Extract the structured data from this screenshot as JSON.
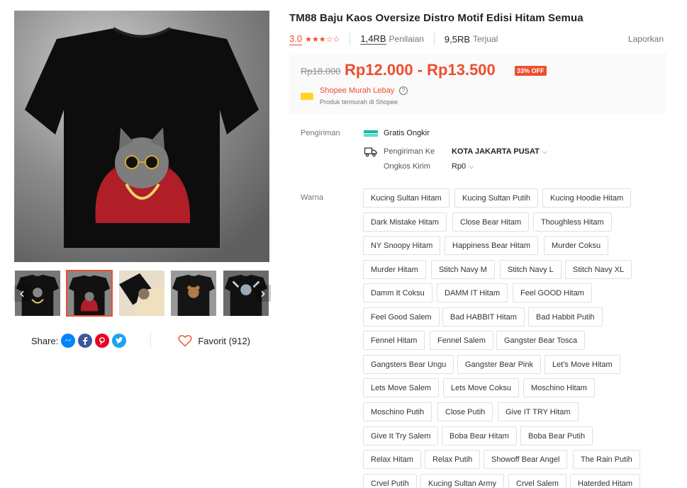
{
  "product": {
    "title": "TM88 Baju Kaos Oversize Distro Motif Edisi Hitam Semua",
    "rating": "3.0",
    "stars": "★★★☆☆",
    "reviews_count": "1,4RB",
    "reviews_label": "Penilaian",
    "sold_count": "9,5RB",
    "sold_label": "Terjual",
    "report_label": "Laporkan"
  },
  "pricing": {
    "original_price": "Rp18.000",
    "price_range": "Rp12.000 - Rp13.500",
    "discount_badge": "33% OFF",
    "murah_title": "Shopee Murah Lebay",
    "murah_help": "?",
    "murah_subtitle": "Produk termurah di Shopee"
  },
  "shipping": {
    "label": "Pengiriman",
    "free_label": "Gratis Ongkir",
    "ship_to_label": "Pengiriman Ke",
    "ship_to_value": "KOTA JAKARTA PUSAT",
    "cost_label": "Ongkos Kirim",
    "cost_value": "Rp0",
    "chevron": "⌵"
  },
  "variants": {
    "label": "Warna",
    "options": [
      "Kucing Sultan Hitam",
      "Kucing Sultan Putih",
      "Kucing Hoodie Hitam",
      "Dark Mistake Hitam",
      "Close Bear Hitam",
      "Thoughless Hitam",
      "NY Snoopy Hitam",
      "Happiness Bear Hitam",
      "Murder Coksu",
      "Murder Hitam",
      "Stitch Navy M",
      "Stitch Navy L",
      "Stitch Navy XL",
      "Damm It Coksu",
      "DAMM IT Hitam",
      "Feel GOOD Hitam",
      "Feel Good Salem",
      "Bad HABBIT Hitam",
      "Bad Habbit Putih",
      "Fennel Hitam",
      "Fennel Salem",
      "Gangster Bear Tosca",
      "Gangsters Bear Ungu",
      "Gangster Bear Pink",
      "Let's Move Hitam",
      "Lets Move Salem",
      "Lets Move Coksu",
      "Moschino Hitam",
      "Moschino Putih",
      "Close Putih",
      "Give IT TRY Hitam",
      "Give It Try Salem",
      "Boba Bear Hitam",
      "Boba Bear Putih",
      "Relax Hitam",
      "Relax Putih",
      "Showoff Bear Angel",
      "The Rain Putih",
      "Crvel Putih",
      "Kucing Sultan Army",
      "Crvel Salem",
      "Haterded Hitam"
    ]
  },
  "gallery": {
    "prev_arrow": "‹",
    "next_arrow": "›"
  },
  "share": {
    "label": "Share:",
    "favorite_label": "Favorit (912)"
  },
  "colors": {
    "accent": "#ee4d2d",
    "muted": "#757575"
  }
}
